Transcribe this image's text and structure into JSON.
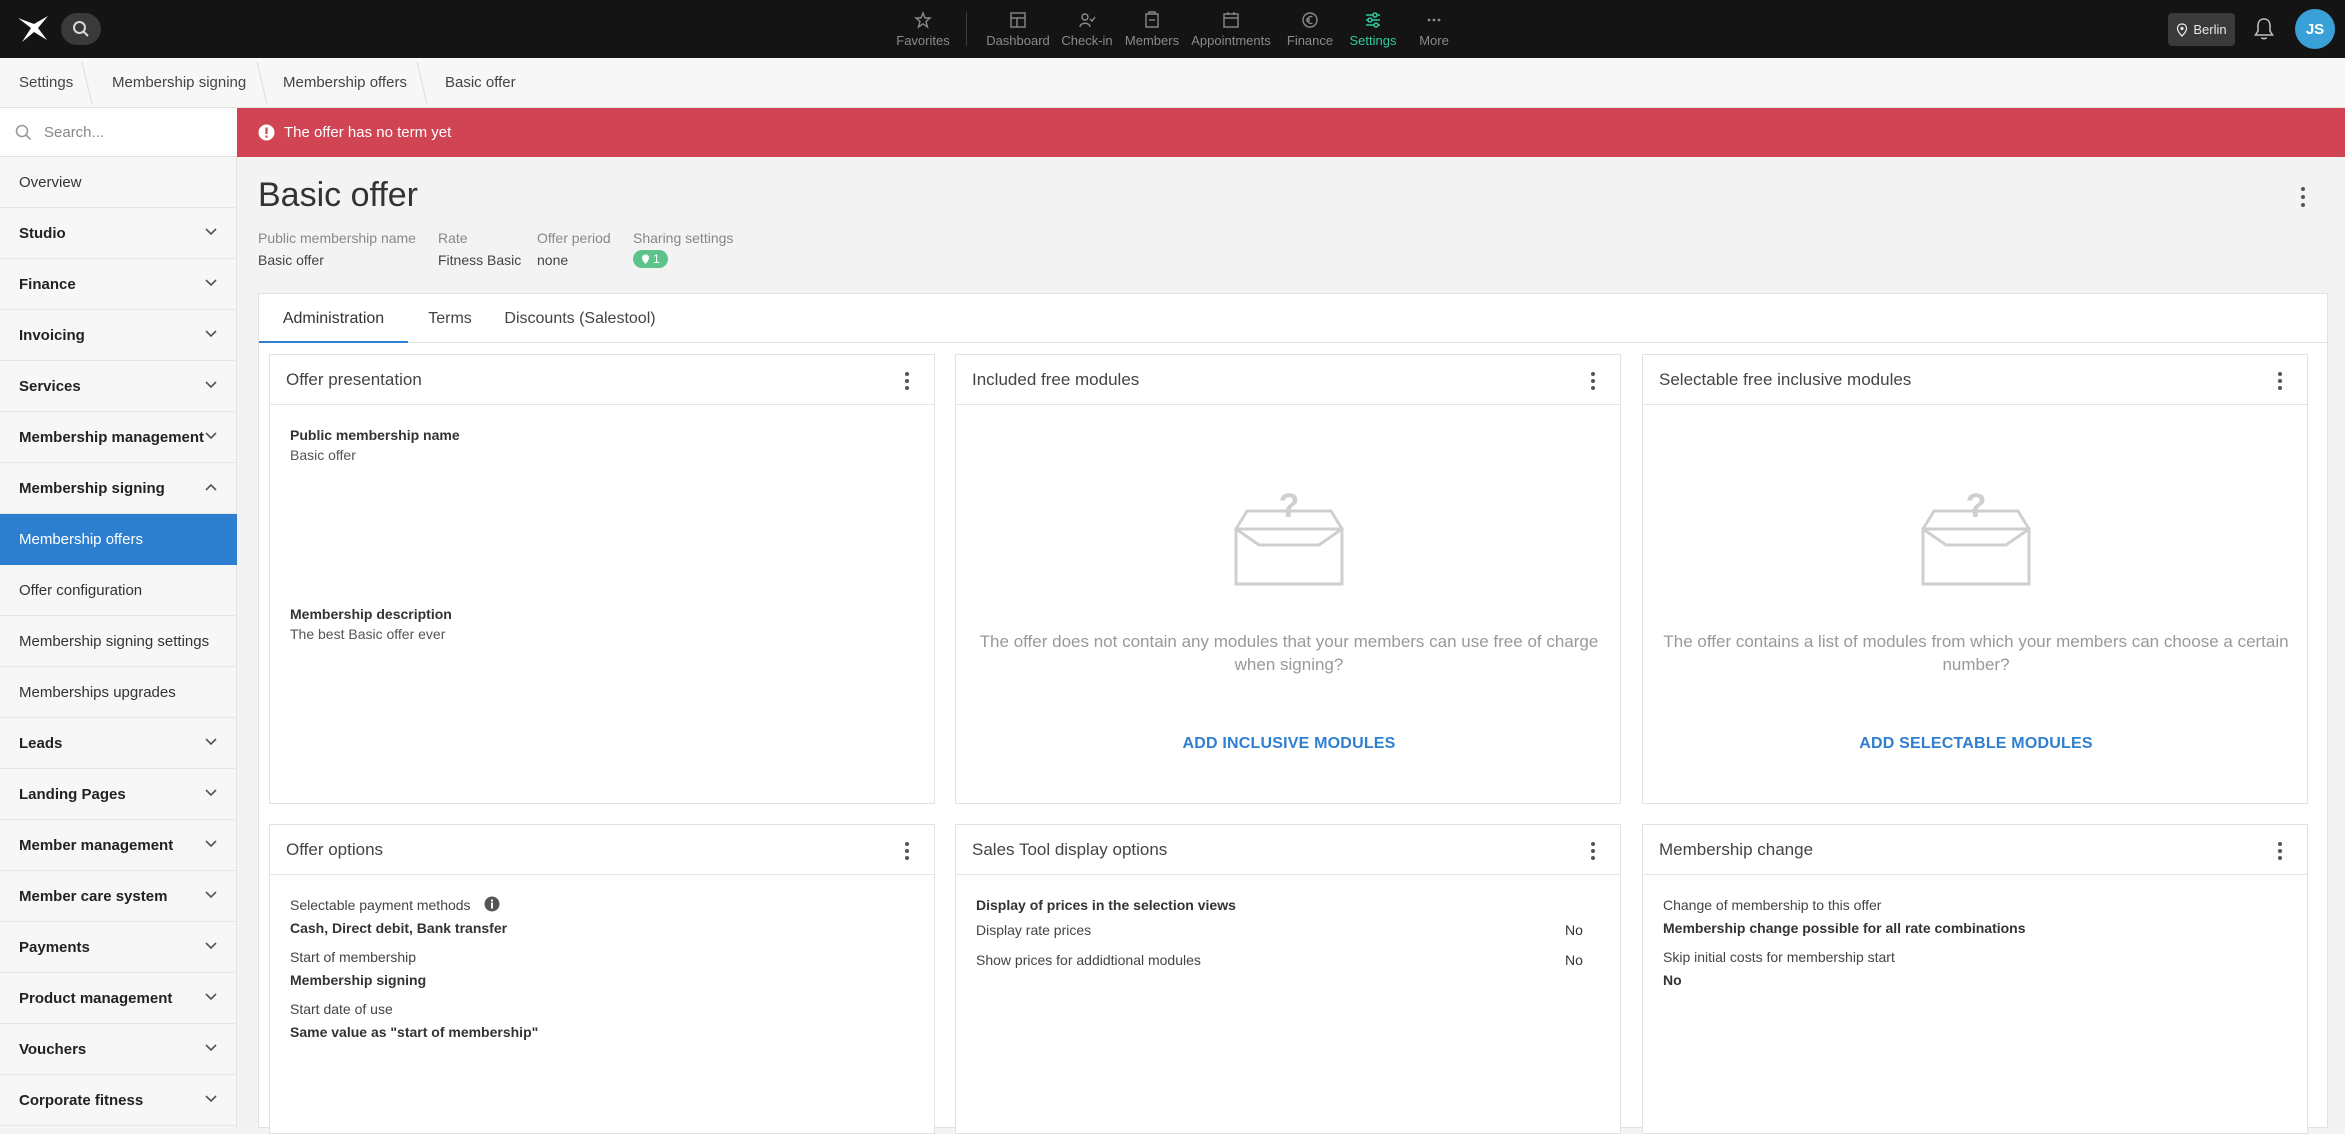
{
  "topnav": {
    "items": [
      {
        "label": "Favorites",
        "icon": "star-icon"
      },
      {
        "label": "Dashboard",
        "icon": "dashboard-icon"
      },
      {
        "label": "Check-in",
        "icon": "checkin-icon"
      },
      {
        "label": "Members",
        "icon": "members-icon"
      },
      {
        "label": "Appointments",
        "icon": "calendar-icon"
      },
      {
        "label": "Finance",
        "icon": "euro-icon"
      },
      {
        "label": "Settings",
        "icon": "sliders-icon"
      },
      {
        "label": "More",
        "icon": "more-icon"
      }
    ],
    "active": "Settings",
    "location": "Berlin",
    "avatar_initials": "JS",
    "accent_color": "#2ec9a0"
  },
  "breadcrumb": [
    "Settings",
    "Membership signing",
    "Membership offers",
    "Basic offer"
  ],
  "sidebar": {
    "search_placeholder": "Search...",
    "items": [
      {
        "label": "Overview"
      },
      {
        "label": "Studio"
      },
      {
        "label": "Finance"
      },
      {
        "label": "Invoicing"
      },
      {
        "label": "Services"
      },
      {
        "label": "Membership management"
      },
      {
        "label": "Membership signing"
      },
      {
        "label": "Membership offers"
      },
      {
        "label": "Offer configuration"
      },
      {
        "label": "Membership signing settings"
      },
      {
        "label": "Memberships upgrades"
      },
      {
        "label": "Leads"
      },
      {
        "label": "Landing Pages"
      },
      {
        "label": "Member management"
      },
      {
        "label": "Member care system"
      },
      {
        "label": "Payments"
      },
      {
        "label": "Product management"
      },
      {
        "label": "Vouchers"
      },
      {
        "label": "Corporate fitness"
      }
    ]
  },
  "banner": {
    "text": "The offer has no term yet",
    "color": "#d04454"
  },
  "header": {
    "title": "Basic offer",
    "meta": [
      {
        "label": "Public membership name",
        "value": "Basic offer"
      },
      {
        "label": "Rate",
        "value": "Fitness Basic"
      },
      {
        "label": "Offer period",
        "value": "none"
      },
      {
        "label": "Sharing settings",
        "value": "1"
      }
    ]
  },
  "tabs": [
    "Administration",
    "Terms",
    "Discounts (Salestool)"
  ],
  "cards": {
    "offer_presentation": {
      "title": "Offer presentation",
      "public_name_label": "Public membership name",
      "public_name_value": "Basic offer",
      "description_label": "Membership description",
      "description_value": "The best Basic offer ever"
    },
    "included_modules": {
      "title": "Included free modules",
      "empty_text": "The offer does not contain any modules that your members can use free of charge when signing?",
      "action": "ADD INCLUSIVE MODULES"
    },
    "selectable_modules": {
      "title": "Selectable free inclusive modules",
      "empty_text": "The offer contains a list of modules from which your members can choose a certain number?",
      "action": "ADD SELECTABLE MODULES"
    },
    "offer_options": {
      "title": "Offer options",
      "payment_label": "Selectable payment methods",
      "payment_value": "Cash, Direct debit, Bank transfer",
      "start_label": "Start of membership",
      "start_value": "Membership signing",
      "use_label": "Start date of use",
      "use_value": "Same value as \"start of membership\""
    },
    "sales_tool": {
      "title": "Sales Tool display options",
      "section_label": "Display of prices in the selection views",
      "rate_prices_label": "Display rate prices",
      "rate_prices_value": "No",
      "module_prices_label": "Show prices for addidtional modules",
      "module_prices_value": "No"
    },
    "membership_change": {
      "title": "Membership change",
      "change_label": "Change of membership to this offer",
      "change_value": "Membership change possible for all rate combinations",
      "skip_label": "Skip initial costs for membership start",
      "skip_value": "No"
    }
  }
}
